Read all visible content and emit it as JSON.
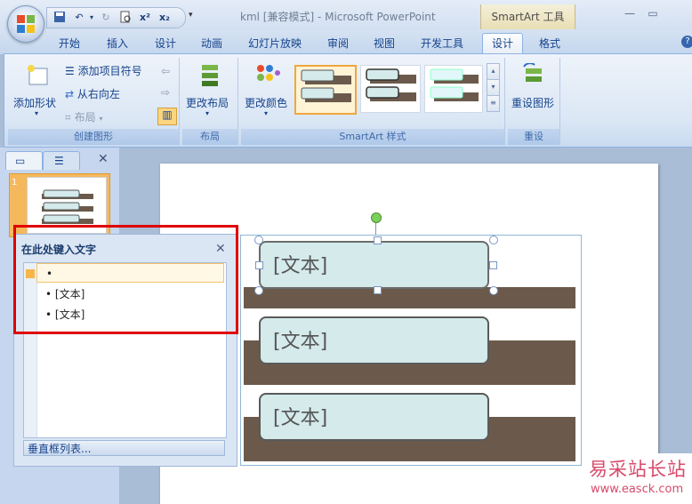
{
  "window": {
    "title": "kml [兼容模式] - Microsoft PowerPoint",
    "contextual_group": "SmartArt 工具"
  },
  "tabs": [
    {
      "label": "开始"
    },
    {
      "label": "插入"
    },
    {
      "label": "设计"
    },
    {
      "label": "动画"
    },
    {
      "label": "幻灯片放映"
    },
    {
      "label": "审阅"
    },
    {
      "label": "视图"
    },
    {
      "label": "开发工具"
    },
    {
      "label": "设计"
    },
    {
      "label": "格式"
    }
  ],
  "ribbon": {
    "create": {
      "add_shape": "添加形状",
      "add_bullet": "添加项目符号",
      "rtl": "从右向左",
      "layout": "布局",
      "group_label": "创建图形"
    },
    "layout": {
      "change_layout": "更改布局",
      "group_label": "布局"
    },
    "styles": {
      "change_colors": "更改颜色",
      "group_label": "SmartArt 样式"
    },
    "reset": {
      "reset_graphic": "重设图形",
      "group_label": "重设"
    }
  },
  "slides_pane": {
    "slide_number": "1"
  },
  "smartart": {
    "boxes": [
      {
        "text": "[文本]"
      },
      {
        "text": "[文本]"
      },
      {
        "text": "[文本]"
      }
    ]
  },
  "text_pane": {
    "title": "在此处键入文字",
    "items": [
      {
        "text": ""
      },
      {
        "text": "[文本]"
      },
      {
        "text": "[文本]"
      }
    ],
    "footer": "垂直框列表..."
  },
  "watermark": {
    "text": "易采站长站",
    "url": "www.easck.com"
  },
  "colors": {
    "accent_red": "#e00000",
    "band_brown": "#6b5a4c",
    "box_fill": "#d4eaeb"
  }
}
